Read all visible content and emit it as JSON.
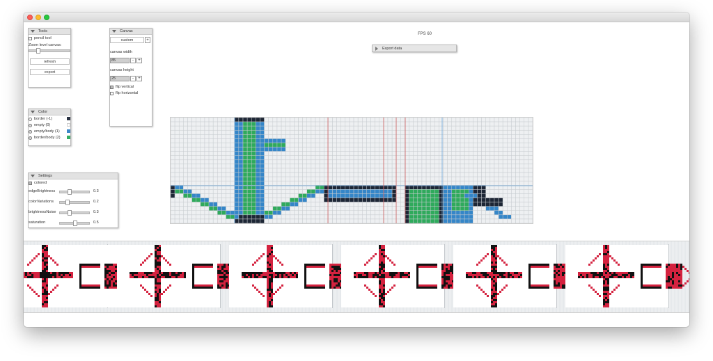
{
  "fps": "FPS 60",
  "export_panel": {
    "title": "Export data"
  },
  "tools": {
    "title": "Tools",
    "pencil_tool": "pencil tool",
    "zoom_label": "Zoom level canvas:",
    "zoom_level": 0.3,
    "refresh": "refresh",
    "export": "export"
  },
  "canvas": {
    "title": "Canvas",
    "preset": "custom",
    "width_label": "canvas width",
    "width_value": "85",
    "height_label": "canvas height",
    "height_value": "25",
    "minus": "-",
    "plus": "+",
    "flip_vertical": "flip vertical",
    "flip_horizontal": "flip horizontal"
  },
  "color": {
    "title": "Color",
    "items": [
      {
        "label": "border (-1)",
        "color": "#2a3243"
      },
      {
        "label": "empty (0)",
        "color": "#ffffff"
      },
      {
        "label": "empty/body (1)",
        "color": "#3d88c9"
      },
      {
        "label": "border/body (2)",
        "color": "#32ad62"
      }
    ]
  },
  "settings": {
    "title": "Settings",
    "colored": "colored",
    "sliders": [
      {
        "label": "edgeBrightness",
        "value": "0.3",
        "level": 0.3
      },
      {
        "label": "colorVariations",
        "value": "0.2",
        "level": 0.2
      },
      {
        "label": "brightnessNoise",
        "value": "0.3",
        "level": 0.3
      },
      {
        "label": "saturation",
        "value": "0.5",
        "level": 0.5
      }
    ]
  },
  "colors": {
    "border": "#1d2635",
    "blue": "#3586c8",
    "green": "#2faa5c",
    "sprite_red": "#d4223f",
    "sprite_black": "#111111"
  }
}
